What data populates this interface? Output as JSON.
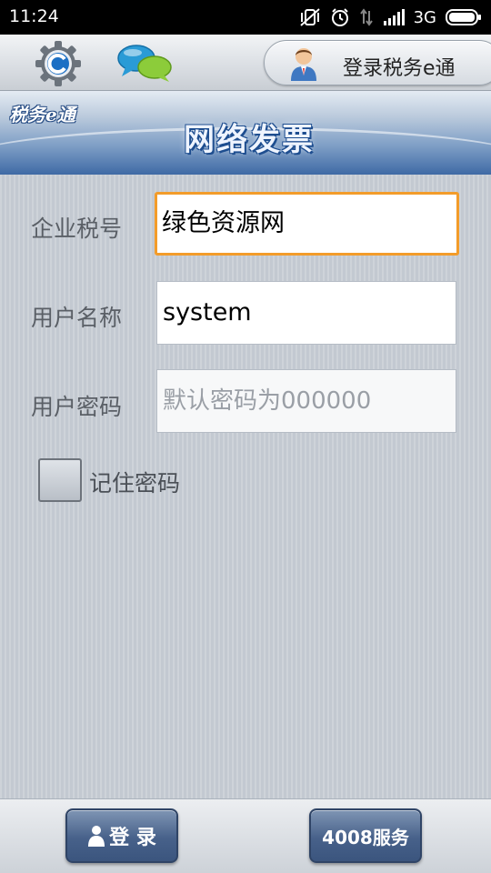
{
  "status_bar": {
    "time": "11:24",
    "network": "3G",
    "icons": [
      "vibrate-off-icon",
      "alarm-icon",
      "data-arrows-icon",
      "signal-icon",
      "battery-icon"
    ]
  },
  "toolbar": {
    "settings_icon": "gear-icon",
    "chat_icon": "chat-bubbles-icon",
    "login_label": "登录税务e通",
    "login_icon": "user-avatar-icon"
  },
  "banner": {
    "brand": "税务e通",
    "title": "网络发票"
  },
  "form": {
    "tax_id_label": "企业税号",
    "tax_id_value": "绿色资源网",
    "username_label": "用户名称",
    "username_value": "system",
    "password_label": "用户密码",
    "password_placeholder": "默认密码为000000",
    "remember_label": "记住密码",
    "remember_checked": false
  },
  "bottom": {
    "login_button": "登 录",
    "service_button": "4008服务"
  },
  "colors": {
    "focus_border": "#f39c2a",
    "button_blue": "#47618a",
    "banner_blue": "#3f6aa5"
  }
}
